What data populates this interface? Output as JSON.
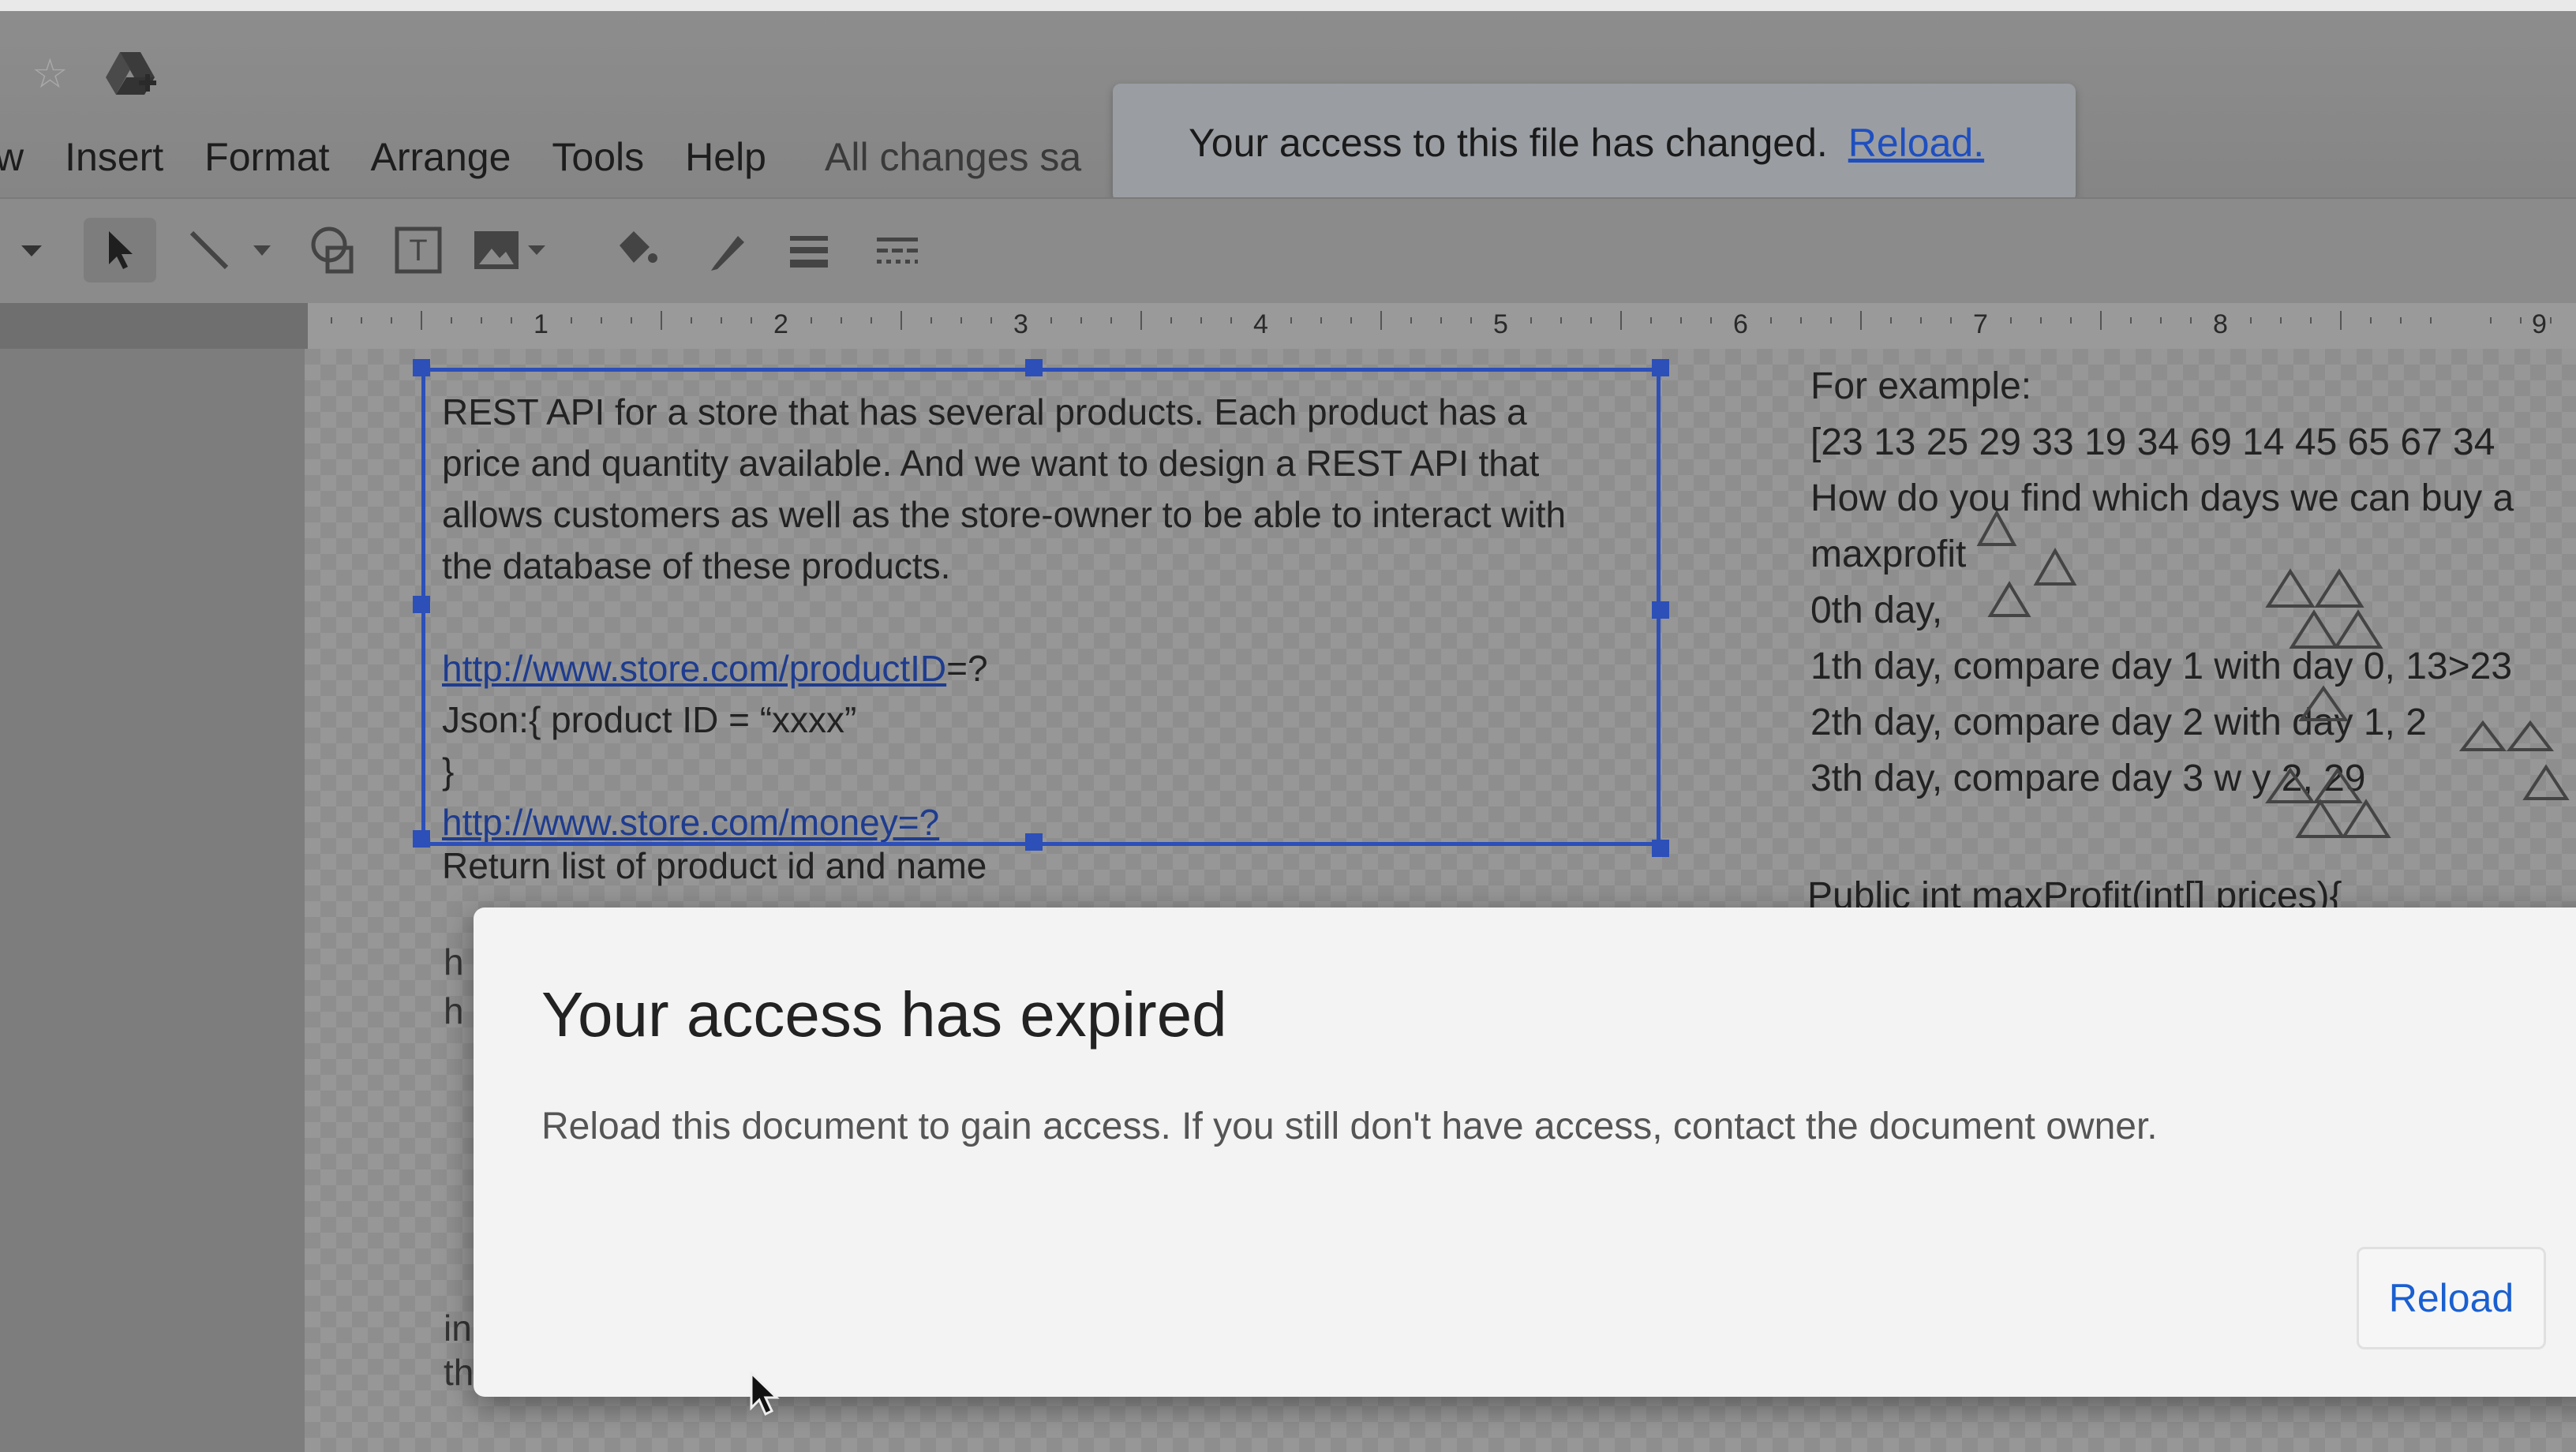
{
  "header": {
    "menu": [
      "w",
      "Insert",
      "Format",
      "Arrange",
      "Tools",
      "Help"
    ],
    "save_status": "All changes sa",
    "banner": {
      "message": "Your access to this file has changed.",
      "link": "Reload."
    }
  },
  "ruler": {
    "numbers": [
      "1",
      "2",
      "3",
      "4",
      "5",
      "6",
      "7",
      "8",
      "9"
    ]
  },
  "left_textbox": {
    "lines": [
      "REST API for a store that has several products. Each product has a",
      "price and quantity available. And we want to design a REST API that",
      "allows customers as well as the store-owner to be able to interact with",
      "the database of these products."
    ],
    "url1": "http://www.store.com/productID",
    "url1_suffix": "=?",
    "json_line": "Json:{   product ID = “xxxx”",
    "brace": "}",
    "url2": "http://www.store.com/money=?",
    "return_line": "Return list of product id and name",
    "behind_chars": [
      "h",
      "h",
      "in",
      "th"
    ]
  },
  "right_textbox": {
    "lines": [
      "For example:",
      "[23 13 25 29 33 19 34 69 14 45 65 67 34",
      "How do you find which days we can buy a",
      "maxprofit",
      "0th day,",
      "1th day, compare day 1 with day 0, 13>23",
      "2th day, compare day 2 with day 1, 2",
      "3th day, compare day 3 w      y 2, 29"
    ],
    "code_line": "Public int maxProfit(int[] prices){"
  },
  "dialog": {
    "title": "Your access has expired",
    "body": "Reload this document to gain access. If you still don't have access, contact the document owner.",
    "button": "Reload"
  }
}
